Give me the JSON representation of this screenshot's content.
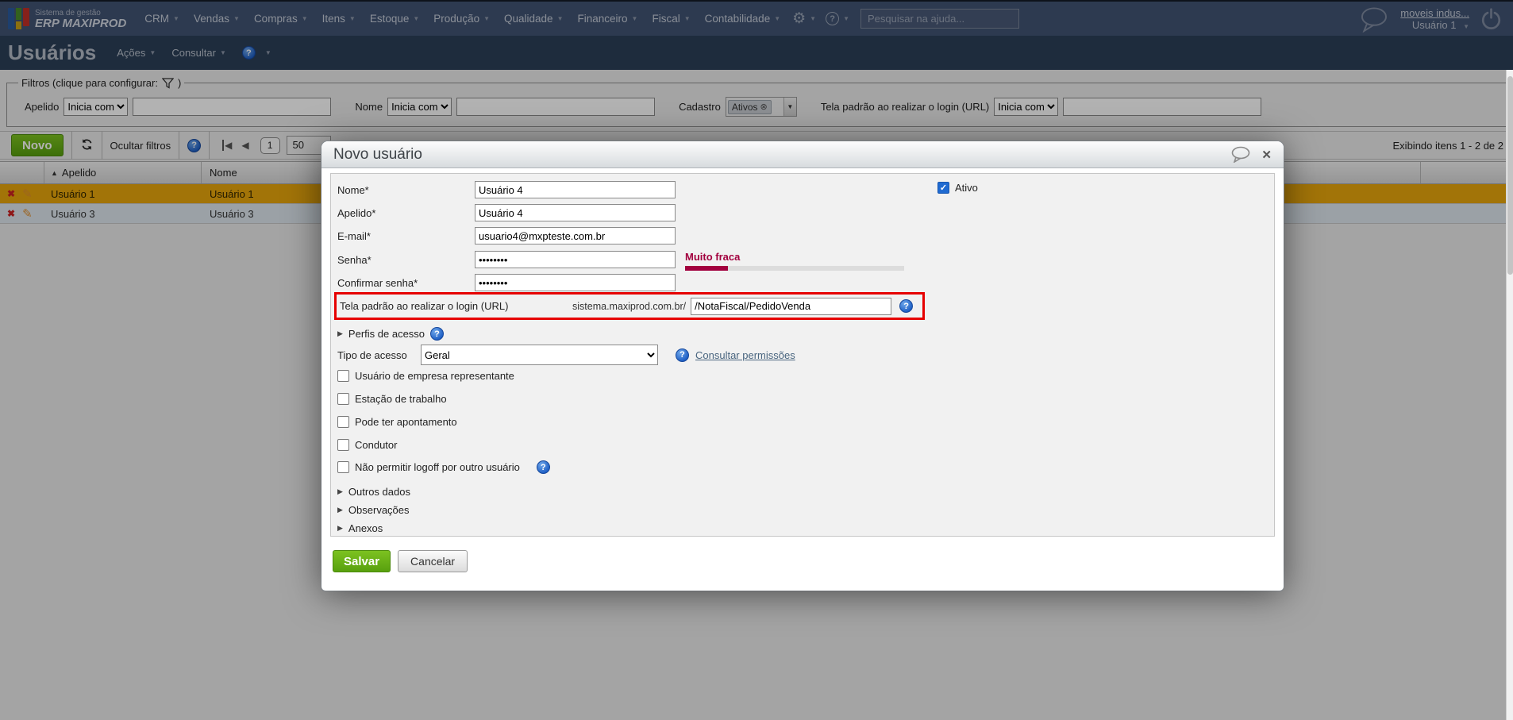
{
  "topbar": {
    "brand_line1": "Sistema de gestão",
    "brand_line2": "ERP MAXIPROD",
    "menus": [
      "CRM",
      "Vendas",
      "Compras",
      "Itens",
      "Estoque",
      "Produção",
      "Qualidade",
      "Financeiro",
      "Fiscal",
      "Contabilidade"
    ],
    "search_placeholder": "Pesquisar na ajuda...",
    "account_link": "moveis indus...",
    "user_label": "Usuário 1"
  },
  "titlebar": {
    "title": "Usuários",
    "actions_menu": "Ações",
    "consult_menu": "Consultar"
  },
  "filters": {
    "legend_prefix": "Filtros (clique para configurar:",
    "legend_suffix": ")",
    "apelido_label": "Apelido",
    "apelido_op": "Inicia com",
    "nome_label": "Nome",
    "nome_op": "Inicia com",
    "cadastro_label": "Cadastro",
    "cadastro_chip": "Ativos",
    "url_label": "Tela padrão ao realizar o login (URL)",
    "url_op": "Inicia com"
  },
  "toolbar": {
    "new_button": "Novo",
    "hide_filters": "Ocultar filtros",
    "page_number": "1",
    "page_size": "50",
    "items_summary": "Exibindo itens 1 - 2 de 2"
  },
  "grid": {
    "col_apelido": "Apelido",
    "col_nome": "Nome",
    "rows": [
      {
        "apelido": "Usuário 1",
        "nome": "Usuário 1"
      },
      {
        "apelido": "Usuário 3",
        "nome": "Usuário 3"
      }
    ]
  },
  "modal": {
    "title": "Novo usuário",
    "nome_label": "Nome*",
    "nome_value": "Usuário 4",
    "apelido_label": "Apelido*",
    "apelido_value": "Usuário 4",
    "email_label": "E-mail*",
    "email_value": "usuario4@mxpteste.com.br",
    "senha_label": "Senha*",
    "senha_value": "••••••••",
    "strength_label": "Muito fraca",
    "confirmar_label": "Confirmar senha*",
    "confirmar_value": "••••••••",
    "url_label": "Tela padrão ao realizar o login (URL)",
    "url_prefix": "sistema.maxiprod.com.br/",
    "url_value": "/NotaFiscal/PedidoVenda",
    "ativo_label": "Ativo",
    "perfis_section": "Perfis de acesso",
    "tipo_label": "Tipo de acesso",
    "tipo_value": "Geral",
    "permissions_link": "Consultar permissões",
    "checkboxes": [
      "Usuário de empresa representante",
      "Estação de trabalho",
      "Pode ter apontamento",
      "Condutor",
      "Não permitir logoff por outro usuário"
    ],
    "sections": [
      "Outros dados",
      "Observações",
      "Anexos"
    ],
    "save_button": "Salvar",
    "cancel_button": "Cancelar"
  },
  "colors": {
    "accent_green": "#69ad18",
    "selected_row_gold": "#e9a70c",
    "alert_red": "#e60000",
    "strength_red": "#a2003e",
    "help_blue": "#1d5ec4"
  }
}
